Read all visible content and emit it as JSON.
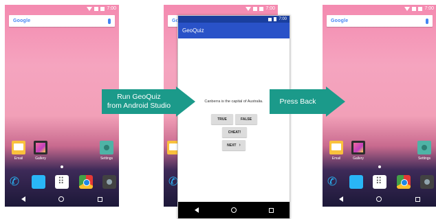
{
  "phone_home": {
    "status_time": "7:00",
    "search_logo": "Google",
    "apps": [
      "Email",
      "Gallery",
      "Settings"
    ],
    "dock_icons": [
      "phone-icon",
      "messages-icon",
      "app-drawer-icon",
      "chrome-icon",
      "camera-icon"
    ]
  },
  "geoquiz": {
    "status_time": "7:00",
    "app_title": "GeoQuiz",
    "question": "Canberra is the capital of Australia.",
    "true_label": "TRUE",
    "false_label": "FALSE",
    "cheat_label": "CHEAT!",
    "next_label": "NEXT",
    "next_chevron": "›"
  },
  "arrows": {
    "first_line1": "Run GeoQuiz",
    "first_line2": "from Android Studio",
    "second": "Press Back"
  },
  "colors": {
    "arrow": "#1b9a8a",
    "appbar": "#2952c8",
    "statusbar": "#1a3f9e"
  }
}
